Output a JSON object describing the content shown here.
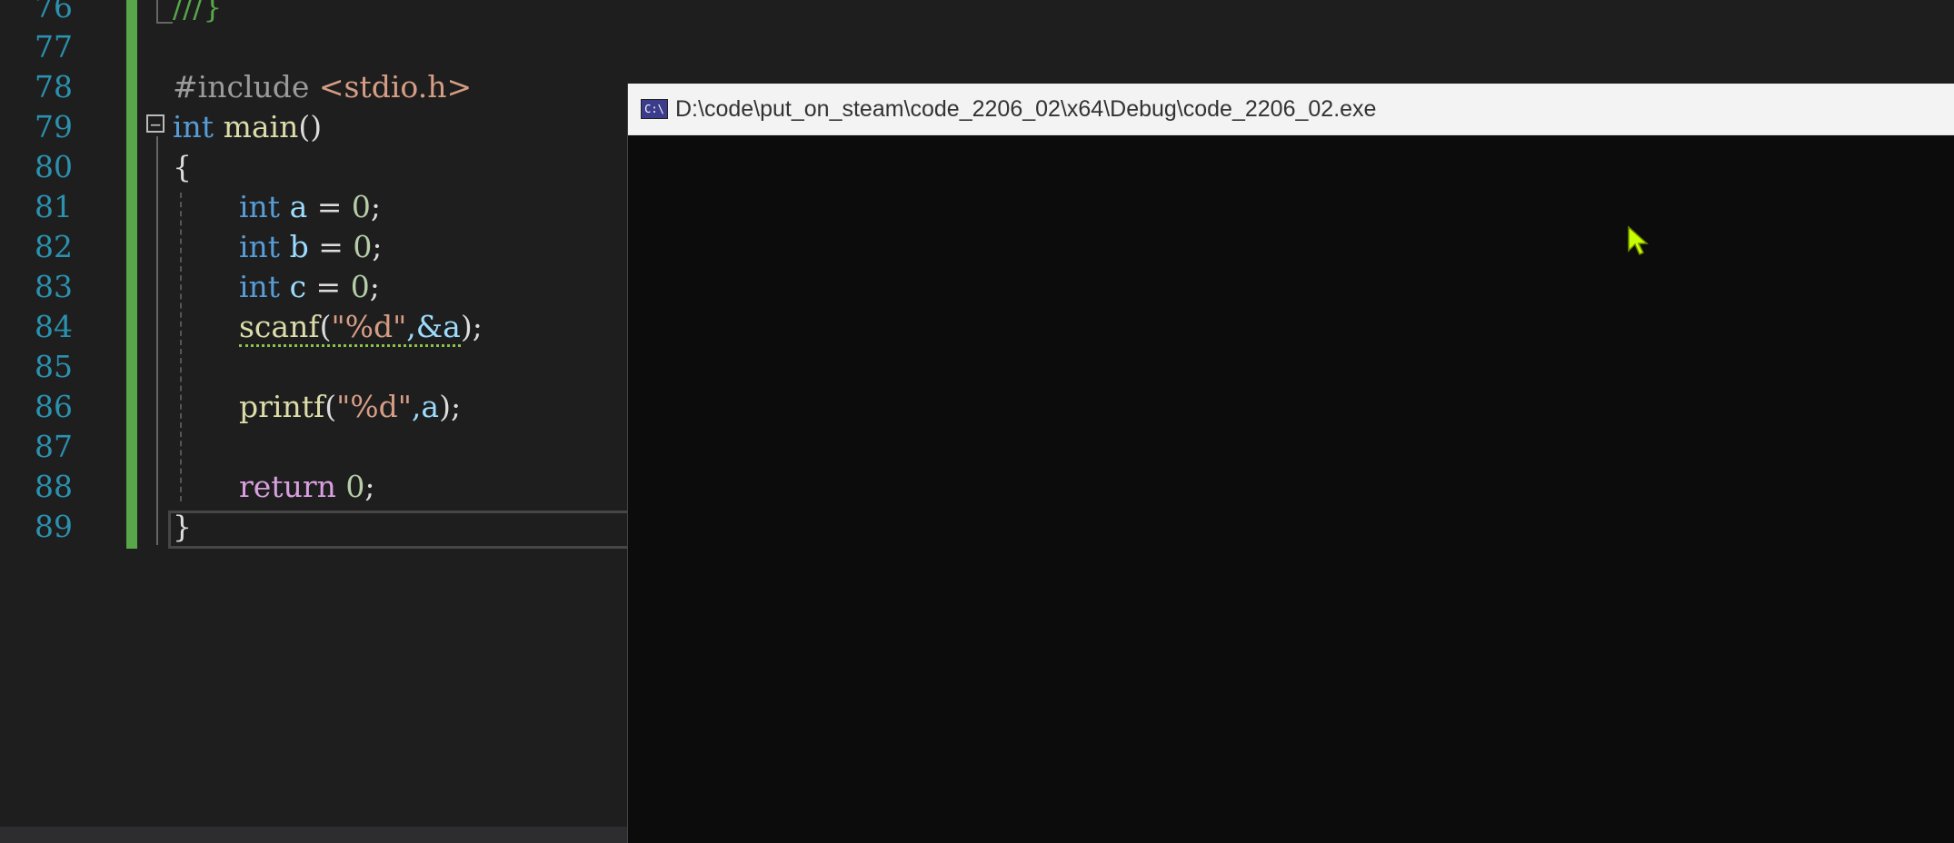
{
  "editor": {
    "line_numbers": [
      "76",
      "77",
      "78",
      "79",
      "80",
      "81",
      "82",
      "83",
      "84",
      "85",
      "86",
      "87",
      "88",
      "89"
    ],
    "line76": "///}",
    "line78": {
      "directive": "#include ",
      "header": "<stdio.h>"
    },
    "line79": {
      "keyword": "int",
      "name": "main",
      "parens": "()"
    },
    "line80": "{",
    "line81": {
      "keyword": "int",
      "rest_var": "a",
      "op": " = ",
      "num": "0",
      "semi": ";"
    },
    "line82": {
      "keyword": "int",
      "rest_var": "b",
      "op": " = ",
      "num": "0",
      "semi": ";"
    },
    "line83": {
      "keyword": "int",
      "rest_var": "c",
      "op": " = ",
      "num": "0",
      "semi": ";"
    },
    "line84": {
      "func": "scanf",
      "open": "(",
      "str": "\"%d\"",
      "args": ",&a",
      "close": ");"
    },
    "line86": {
      "func": "printf",
      "open": "(",
      "str": "\"%d\"",
      "args": ",a",
      "close": ");"
    },
    "line88": {
      "keyword": "return",
      "num": "0",
      "semi": ";"
    },
    "line89": "}",
    "collapse_glyph": "−"
  },
  "console": {
    "title": "D:\\code\\put_on_steam\\code_2206_02\\x64\\Debug\\code_2206_02.exe",
    "icon_label": "C:\\",
    "output": ""
  },
  "colors": {
    "editor_bg": "#1e1e1e",
    "line_number": "#2b91af",
    "keyword": "#569cd6",
    "function": "#dcdcaa",
    "string": "#d69d85",
    "change_bar": "#57a64a",
    "console_bg": "#0c0c0c",
    "cursor": "#c8ff00"
  }
}
